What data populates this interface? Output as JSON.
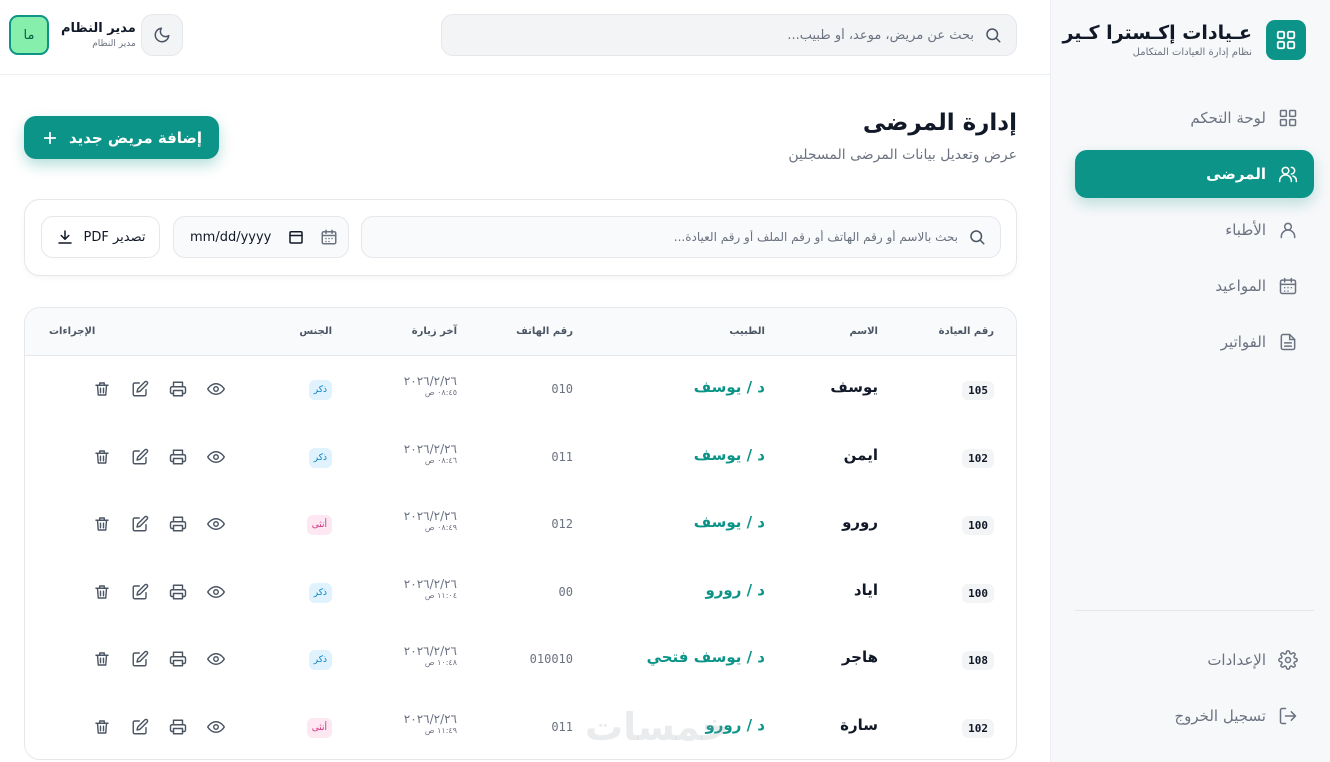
{
  "brand": {
    "title": "عـيادات إكـسترا كـير",
    "subtitle": "نظام إدارة العيادات المتكامل"
  },
  "sidebar": {
    "items": [
      {
        "label": "لوحة التحكم",
        "icon": "dashboard-icon"
      },
      {
        "label": "المرضى",
        "icon": "users-icon",
        "active": true
      },
      {
        "label": "الأطباء",
        "icon": "user-icon"
      },
      {
        "label": "المواعيد",
        "icon": "calendar-icon"
      },
      {
        "label": "الفواتير",
        "icon": "file-icon"
      }
    ],
    "bottom": [
      {
        "label": "الإعدادات",
        "icon": "gear-icon"
      },
      {
        "label": "تسجيل الخروج",
        "icon": "logout-icon"
      }
    ]
  },
  "header": {
    "search_placeholder": "بحث عن مريض، موعد، أو طبيب...",
    "user_name": "مدير النظام",
    "user_role": "مدير النظام",
    "avatar_initials": "ما"
  },
  "page": {
    "title": "إدارة المرضى",
    "subtitle": "عرض وتعديل بيانات المرضى المسجلين",
    "add_button": "إضافة مريض جديد"
  },
  "filters": {
    "search_placeholder": "بحث بالاسم أو رقم الهاتف أو رقم الملف أو رقم العيادة...",
    "date_placeholder": "mm/dd/yyyy",
    "export_label": "تصدير PDF"
  },
  "table": {
    "headers": {
      "clinic_no": "رقم العيادة",
      "name": "الاسم",
      "doctor": "الطبيب",
      "phone": "رقم الهاتف",
      "last_visit": "آخر زيارة",
      "gender": "الجنس",
      "actions": "الإجراءات"
    },
    "rows": [
      {
        "clinic_no": "105",
        "name": "يوسف",
        "doctor": "د / يوسف",
        "phone": "010",
        "date": "٢٠٢٦/٢/٢٦",
        "time": "٠٨:٤٥ ص",
        "gender": "ذكر",
        "gender_type": "male"
      },
      {
        "clinic_no": "102",
        "name": "ايمن",
        "doctor": "د / يوسف",
        "phone": "011",
        "date": "٢٠٢٦/٢/٢٦",
        "time": "٠٨:٤٦ ص",
        "gender": "ذكر",
        "gender_type": "male"
      },
      {
        "clinic_no": "100",
        "name": "رورو",
        "doctor": "د / يوسف",
        "phone": "012",
        "date": "٢٠٢٦/٢/٢٦",
        "time": "٠٨:٤٩ ص",
        "gender": "أنثى",
        "gender_type": "female"
      },
      {
        "clinic_no": "100",
        "name": "اياد",
        "doctor": "د / رورو",
        "phone": "00",
        "date": "٢٠٢٦/٢/٢٦",
        "time": "١١:٠٤ ص",
        "gender": "ذكر",
        "gender_type": "male"
      },
      {
        "clinic_no": "108",
        "name": "هاجر",
        "doctor": "د / يوسف فتحي",
        "phone": "010010",
        "date": "٢٠٢٦/٢/٢٦",
        "time": "١٠:٤٨ ص",
        "gender": "ذكر",
        "gender_type": "male"
      },
      {
        "clinic_no": "102",
        "name": "سارة",
        "doctor": "د / رورو",
        "phone": "011",
        "date": "٢٠٢٦/٢/٢٦",
        "time": "١١:٤٩ ص",
        "gender": "أنثى",
        "gender_type": "female"
      }
    ]
  },
  "watermark": "خمسات",
  "colors": {
    "accent": "#0d9488",
    "male_badge": "#e0f2fe",
    "female_badge": "#fce7f3"
  }
}
